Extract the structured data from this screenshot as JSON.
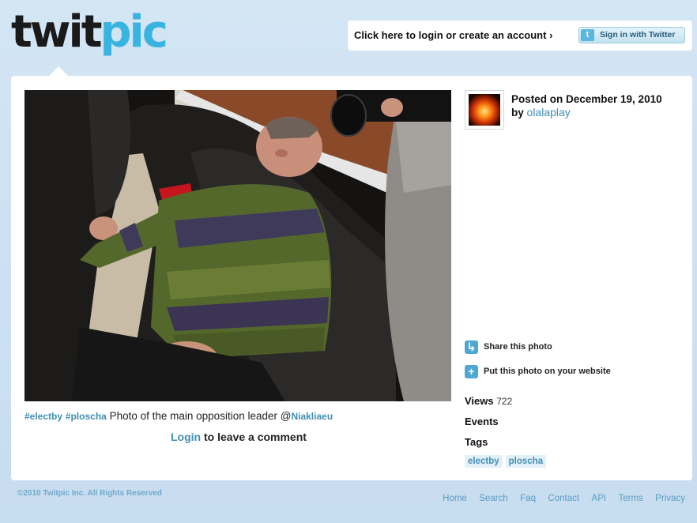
{
  "brand": {
    "part1": "twit",
    "part2": "pic",
    "accent": "#39b4e0"
  },
  "header": {
    "login_text": "Click here to login or create an account ›",
    "twitter_button": "Sign in with Twitter",
    "twitter_icon": "twitter-bird-icon"
  },
  "photo": {
    "caption_tag1": "#electby",
    "caption_tag2": "#ploscha",
    "caption_text": "Photo of the main opposition leader @",
    "caption_mention": "Niakliaeu"
  },
  "comment": {
    "login_link": "Login",
    "rest": " to leave a comment"
  },
  "meta": {
    "posted_label": "Posted on December 19, 2010",
    "by_label": "by",
    "username": "olalaplay"
  },
  "sidebar": {
    "share_label": "Share this photo",
    "embed_label": "Put this photo on your website",
    "views_label": "Views",
    "views_count": "722",
    "events_label": "Events",
    "tags_label": "Tags",
    "tags": [
      "electby",
      "ploscha"
    ]
  },
  "footer": {
    "copyright": "©2010 Twitpic Inc. All Rights Reserved",
    "links": [
      "Home",
      "Search",
      "Faq",
      "Contact",
      "API",
      "Terms",
      "Privacy"
    ]
  }
}
